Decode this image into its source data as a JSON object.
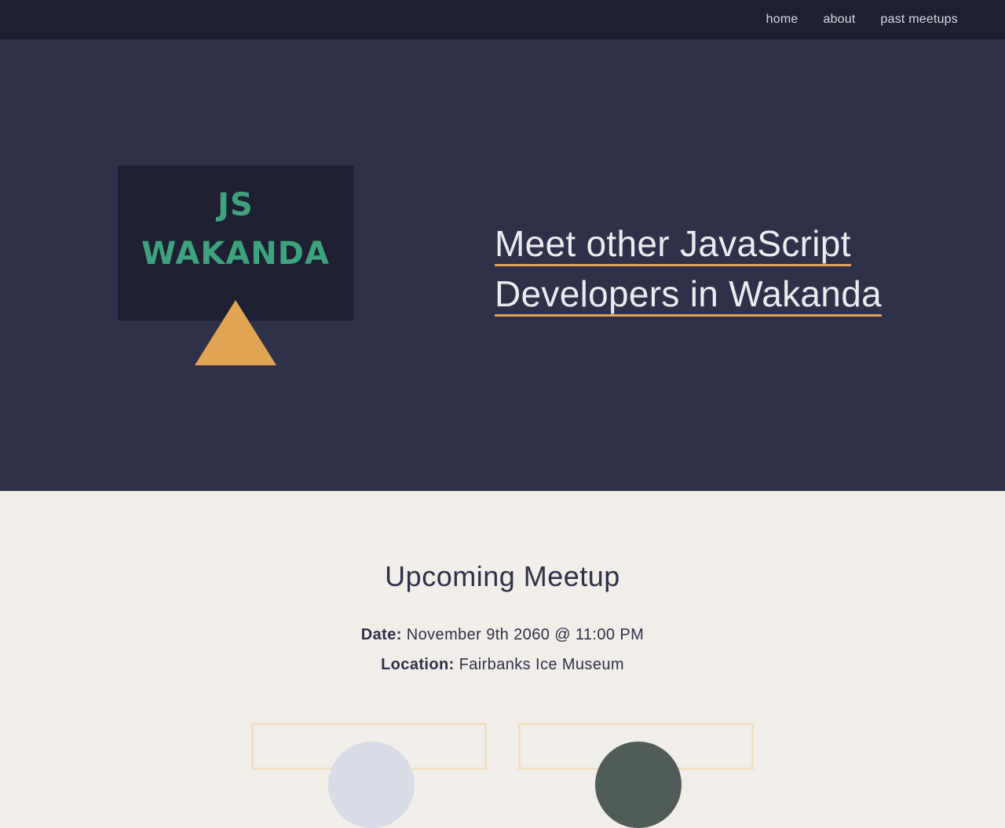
{
  "nav": {
    "items": [
      {
        "label": "home"
      },
      {
        "label": "about"
      },
      {
        "label": "past meetups"
      }
    ]
  },
  "hero": {
    "logo": {
      "line1": "JS",
      "line2": "WAKANDA"
    },
    "tagline": {
      "line1": "Meet other JavaScript",
      "line2": "Developers in Wakanda"
    }
  },
  "upcoming": {
    "title": "Upcoming Meetup",
    "date_label": "Date:",
    "date_value": "November 9th 2060 @ 11:00 PM",
    "location_label": "Location:",
    "location_value": "Fairbanks Ice Museum"
  },
  "colors": {
    "nav_bg": "#1e1f33",
    "hero_bg": "#2f3049",
    "accent": "#e0a453",
    "logo_green": "#3fa27e",
    "page_bg": "#f1eee9"
  }
}
